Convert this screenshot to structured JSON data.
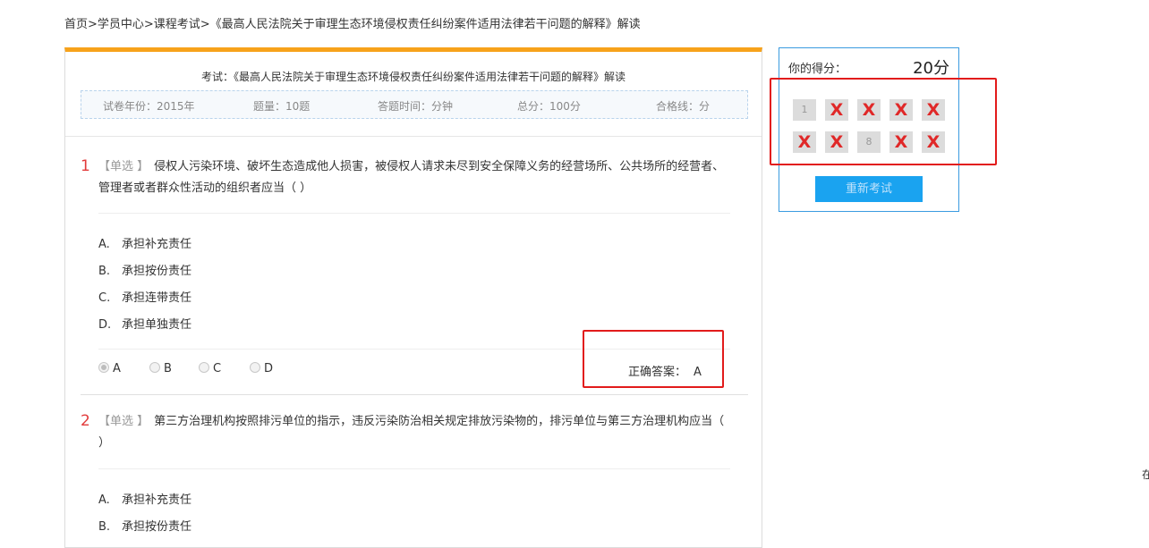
{
  "breadcrumb": "首页>学员中心>课程考试>《最高人民法院关于审理生态环境侵权责任纠纷案件适用法律若干问题的解释》解读",
  "exam": {
    "title": "考试：《最高人民法院关于审理生态环境侵权责任纠纷案件适用法律若干问题的解释》解读",
    "year": "试卷年份：2015年",
    "count": "题量：10题",
    "time": "答题时间：分钟",
    "total": "总分：100分",
    "pass": "合格线：分"
  },
  "questions": [
    {
      "number": "1",
      "tag": "【单选 】",
      "text": "侵权人污染环境、破坏生态造成他人损害，被侵权人请求未尽到安全保障义务的经营场所、公共场所的经营者、管理者或者群众性活动的组织者应当（ ）",
      "options": [
        {
          "letter": "A.",
          "text": "承担补充责任"
        },
        {
          "letter": "B.",
          "text": "承担按份责任"
        },
        {
          "letter": "C.",
          "text": "承担连带责任"
        },
        {
          "letter": "D.",
          "text": "承担单独责任"
        }
      ],
      "choices": [
        "A",
        "B",
        "C",
        "D"
      ],
      "selected": "A",
      "answer_label": "正确答案：",
      "answer": "A"
    },
    {
      "number": "2",
      "tag": "【单选 】",
      "text": "第三方治理机构按照排污单位的指示，违反污染防治相关规定排放污染物的，排污单位与第三方治理机构应当（ ）",
      "options": [
        {
          "letter": "A.",
          "text": "承担补充责任"
        },
        {
          "letter": "B.",
          "text": "承担按份责任"
        }
      ]
    }
  ],
  "score": {
    "label": "你的得分：",
    "value": "20分",
    "cells": [
      {
        "label": "1",
        "wrong": false
      },
      {
        "label": "X",
        "wrong": true
      },
      {
        "label": "X",
        "wrong": true
      },
      {
        "label": "X",
        "wrong": true
      },
      {
        "label": "X",
        "wrong": true
      },
      {
        "label": "X",
        "wrong": true
      },
      {
        "label": "X",
        "wrong": true
      },
      {
        "label": "8",
        "wrong": false
      },
      {
        "label": "X",
        "wrong": true
      },
      {
        "label": "X",
        "wrong": true
      }
    ],
    "retry_label": "重新考试"
  },
  "edge_text": "在",
  "colors": {
    "accent": "#f7a21b",
    "wrong": "#e02828",
    "button": "#1aa3f0",
    "highlight": "#e21b1b"
  }
}
